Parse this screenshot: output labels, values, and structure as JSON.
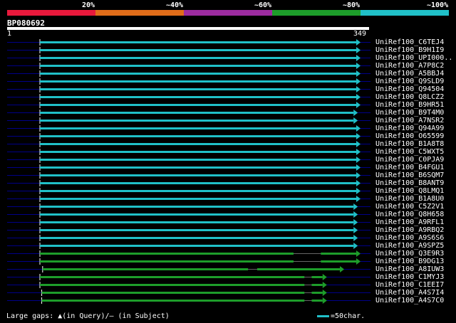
{
  "scale": {
    "ticks": [
      "20%",
      "~40%",
      "~60%",
      "~80%",
      "~100%"
    ],
    "colors": [
      "#e8193c",
      "#e06d1a",
      "#9c2ca0",
      "#1d9d2a",
      "#20c0c8"
    ]
  },
  "query": {
    "id": "BP080692",
    "start": "1",
    "end": "349"
  },
  "colors": {
    "cyan": "#20c0c8",
    "green": "#1d9d2a",
    "gap": "#000088"
  },
  "hits": [
    {
      "name": "UniRef100_C6TEJ4",
      "color": "cyan",
      "s": 1,
      "e": 349
    },
    {
      "name": "UniRef100_B9H1I9",
      "color": "cyan",
      "s": 1,
      "e": 349
    },
    {
      "name": "UniRef100_UPI000..",
      "color": "cyan",
      "s": 1,
      "e": 349
    },
    {
      "name": "UniRef100_A7P8C2",
      "color": "cyan",
      "s": 1,
      "e": 349
    },
    {
      "name": "UniRef100_A5BBJ4",
      "color": "cyan",
      "s": 1,
      "e": 349
    },
    {
      "name": "UniRef100_Q9SLD9",
      "color": "cyan",
      "s": 1,
      "e": 349
    },
    {
      "name": "UniRef100_Q94504",
      "color": "cyan",
      "s": 1,
      "e": 349
    },
    {
      "name": "UniRef100_Q8LCZ2",
      "color": "cyan",
      "s": 1,
      "e": 349
    },
    {
      "name": "UniRef100_B9HR51",
      "color": "cyan",
      "s": 1,
      "e": 349
    },
    {
      "name": "UniRef100_B9T4M0",
      "color": "cyan",
      "s": 1,
      "e": 346
    },
    {
      "name": "UniRef100_A7NSR2",
      "color": "cyan",
      "s": 1,
      "e": 346
    },
    {
      "name": "UniRef100_Q94A99",
      "color": "cyan",
      "s": 1,
      "e": 349
    },
    {
      "name": "UniRef100_O65599",
      "color": "cyan",
      "s": 1,
      "e": 349
    },
    {
      "name": "UniRef100_B1A8T8",
      "color": "cyan",
      "s": 1,
      "e": 349
    },
    {
      "name": "UniRef100_C5WXT5",
      "color": "cyan",
      "s": 1,
      "e": 349
    },
    {
      "name": "UniRef100_C0PJA9",
      "color": "cyan",
      "s": 1,
      "e": 349
    },
    {
      "name": "UniRef100_B4FGU1",
      "color": "cyan",
      "s": 1,
      "e": 349
    },
    {
      "name": "UniRef100_B6SQM7",
      "color": "cyan",
      "s": 1,
      "e": 349
    },
    {
      "name": "UniRef100_B8ANT9",
      "color": "cyan",
      "s": 1,
      "e": 349
    },
    {
      "name": "UniRef100_Q8LMQ1",
      "color": "cyan",
      "s": 1,
      "e": 349
    },
    {
      "name": "UniRef100_B1A8U0",
      "color": "cyan",
      "s": 1,
      "e": 349
    },
    {
      "name": "UniRef100_C5Z2V1",
      "color": "cyan",
      "s": 1,
      "e": 346
    },
    {
      "name": "UniRef100_Q8H658",
      "color": "cyan",
      "s": 1,
      "e": 346
    },
    {
      "name": "UniRef100_A9RFL1",
      "color": "cyan",
      "s": 1,
      "e": 346
    },
    {
      "name": "UniRef100_A9RBQ2",
      "color": "cyan",
      "s": 1,
      "e": 346
    },
    {
      "name": "UniRef100_A9S6S6",
      "color": "cyan",
      "s": 1,
      "e": 346
    },
    {
      "name": "UniRef100_A9SPZ5",
      "color": "cyan",
      "s": 1,
      "e": 346
    },
    {
      "name": "UniRef100_Q3E9R3",
      "color": "green",
      "s": 1,
      "e": 349,
      "gap": [
        280,
        310
      ]
    },
    {
      "name": "UniRef100_B9DG13",
      "color": "green",
      "s": 1,
      "e": 349,
      "gap": [
        280,
        310
      ]
    },
    {
      "name": "UniRef100_A8IUW3",
      "color": "green",
      "s": 4,
      "e": 331,
      "gap": [
        230,
        240
      ]
    },
    {
      "name": "UniRef100_C1MYJ3",
      "color": "green",
      "s": 1,
      "e": 312,
      "gap": [
        292,
        300
      ]
    },
    {
      "name": "UniRef100_C1EEI7",
      "color": "green",
      "s": 1,
      "e": 312,
      "gap": [
        292,
        300
      ]
    },
    {
      "name": "UniRef100_A4S7I4",
      "color": "green",
      "s": 3,
      "e": 312,
      "gap": [
        292,
        300
      ]
    },
    {
      "name": "UniRef100_A4S7C0",
      "color": "green",
      "s": 3,
      "e": 312,
      "gap": [
        292,
        300
      ]
    }
  ],
  "footer": {
    "text": "Large gaps: ▲(in Query)/– (in Subject)",
    "legend": "=50char."
  }
}
